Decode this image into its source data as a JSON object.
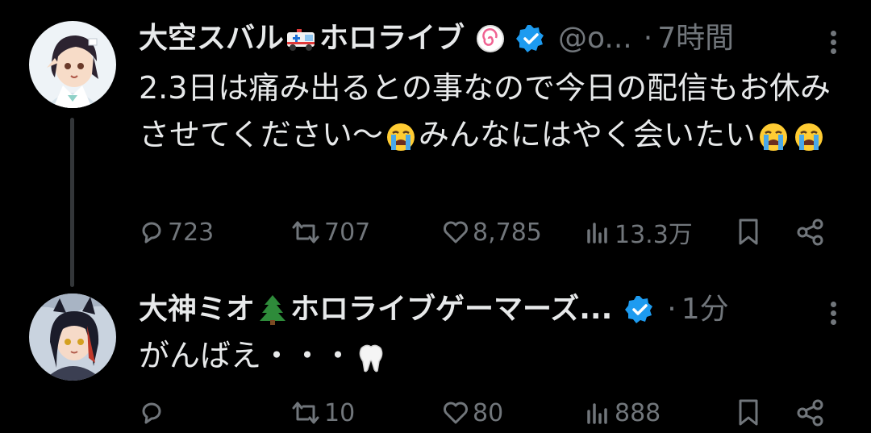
{
  "tweets": [
    {
      "author": "大空スバル",
      "author_suffix": "ホロライブ",
      "author_emojis": [
        "ambulance-emoji",
        "naruto-emoji"
      ],
      "handle": "@o...",
      "time": "7時間",
      "text_parts": [
        "2.3日は痛み出るとの事なので今日の配信もお休みさせてください〜",
        "みんなにはやく会いたい"
      ],
      "stats": {
        "replies": "723",
        "retweets": "707",
        "likes": "8,785",
        "views": "13.3万"
      }
    },
    {
      "author": "大神ミオ",
      "author_suffix": "ホロライブゲーマーズ...",
      "author_emojis": [
        "evergreen-tree-emoji"
      ],
      "time": "1分",
      "text": "がんばえ・・・",
      "stats": {
        "replies": "",
        "retweets": "10",
        "likes": "80",
        "views": "888"
      }
    }
  ],
  "separator_dot": "·",
  "colors": {
    "background": "#000000",
    "text": "#e7e9ea",
    "muted": "#71767b",
    "verified": "#1d9bf0"
  }
}
